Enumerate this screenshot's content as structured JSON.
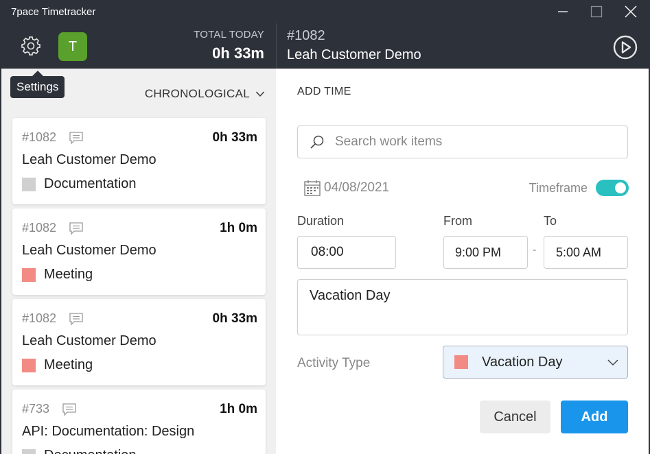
{
  "window": {
    "title": "7pace Timetracker"
  },
  "header": {
    "avatar_letter": "T",
    "total_label": "TOTAL TODAY",
    "total_value": "0h 33m",
    "current_id": "#1082",
    "current_title": "Leah Customer Demo"
  },
  "sidebar": {
    "tooltip": "Settings",
    "sort_label": "CHRONOLOGICAL",
    "entries": [
      {
        "id": "#1082",
        "duration": "0h 33m",
        "title": "Leah Customer Demo",
        "activity": "Documentation",
        "color": "#d0d0d0"
      },
      {
        "id": "#1082",
        "duration": "1h 0m",
        "title": "Leah Customer Demo",
        "activity": "Meeting",
        "color": "#f28b84"
      },
      {
        "id": "#1082",
        "duration": "0h 33m",
        "title": "Leah Customer Demo",
        "activity": "Meeting",
        "color": "#f28b84"
      },
      {
        "id": "#733",
        "duration": "1h 0m",
        "title": "API: Documentation: Design",
        "activity": "Documentation",
        "color": "#d0d0d0"
      }
    ]
  },
  "form": {
    "heading": "ADD TIME",
    "search_placeholder": "Search work items",
    "date": "04/08/2021",
    "timeframe_label": "Timeframe",
    "timeframe_on": true,
    "duration_label": "Duration",
    "duration_value": "08:00",
    "from_label": "From",
    "from_value": "9:00 PM",
    "to_label": "To",
    "to_value": "5:00 AM",
    "separator": "-",
    "notes": "Vacation Day",
    "activity_label": "Activity Type",
    "activity_value": "Vacation Day",
    "activity_color": "#f28b84",
    "cancel_label": "Cancel",
    "add_label": "Add"
  },
  "colors": {
    "accent": "#1a95ec",
    "toggle": "#2ac0c0",
    "avatar": "#5aa02c",
    "header_bg": "#2d3139"
  },
  "icons": [
    "gear-icon",
    "play-icon",
    "comment-icon",
    "search-icon",
    "calendar-icon",
    "chevron-down-icon",
    "minimize-icon",
    "maximize-icon",
    "close-icon"
  ]
}
